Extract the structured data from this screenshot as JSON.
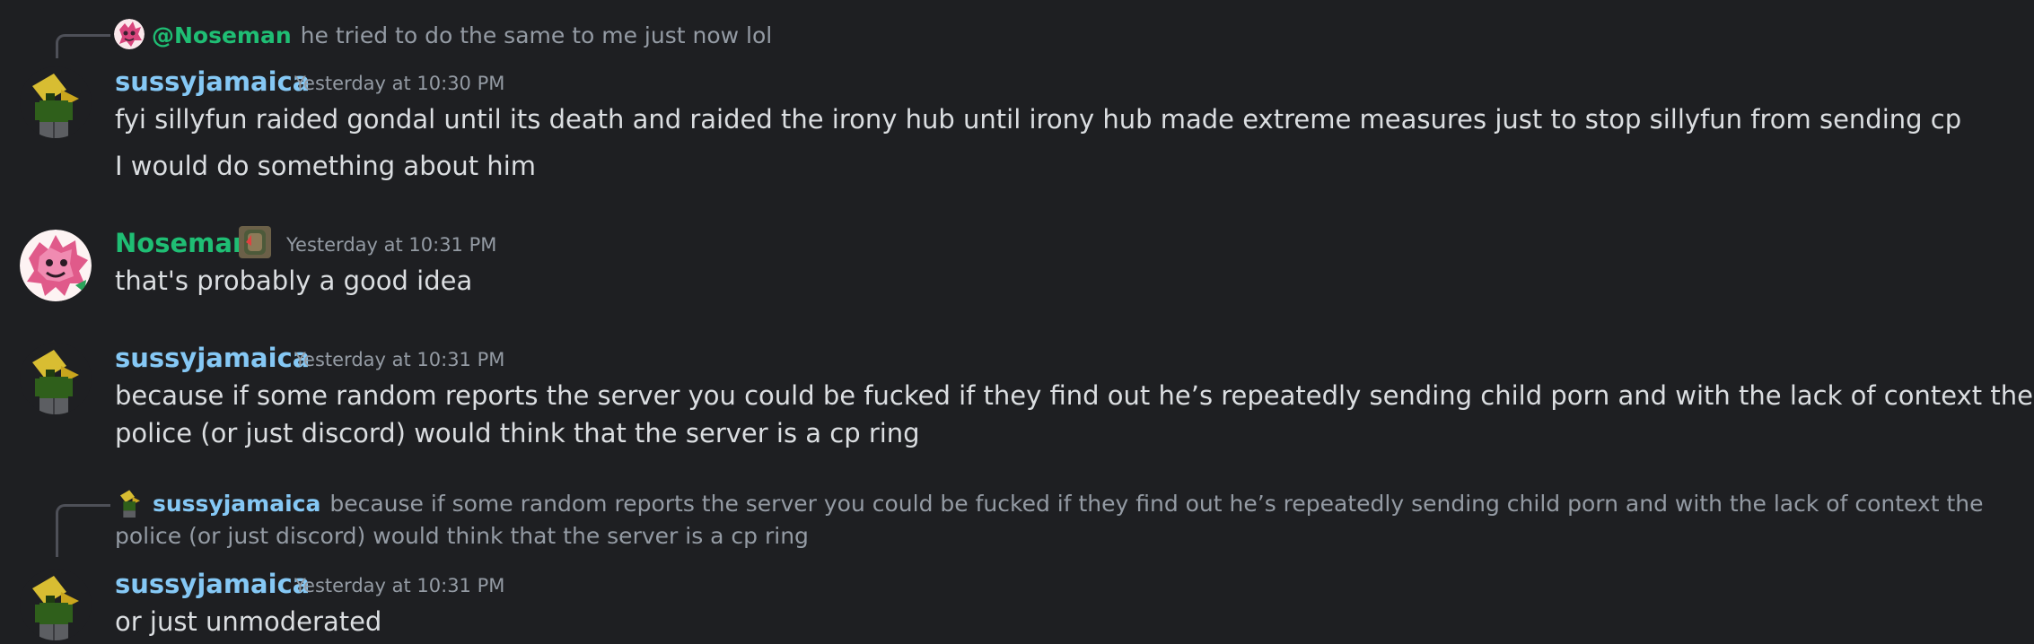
{
  "messages": [
    {
      "reply": {
        "author": "@Noseman",
        "text": "he tried to do the same to me just now lol"
      },
      "author": "sussyjamaica",
      "timestamp": "Yesterday at 10:30 PM",
      "lines": [
        "fyi sillyfun raided gondal until its death and raided the irony hub until irony hub made extreme measures just to stop sillyfun from sending cp",
        "I would do something about him"
      ]
    },
    {
      "author": "Noseman",
      "timestamp": "Yesterday at 10:31 PM",
      "lines": [
        "that's probably a good idea"
      ]
    },
    {
      "author": "sussyjamaica",
      "timestamp": "Yesterday at 10:31 PM",
      "lines": [
        "because if some random reports the server you could be fucked if they find out he’s repeatedly sending child porn and with the lack of context the police (or just discord) would think that the server is a cp ring"
      ]
    },
    {
      "reply": {
        "author": "sussyjamaica",
        "text": "because if some random reports the server you could be fucked if they find out he’s repeatedly sending child porn and with the lack of context the police (or just discord) would think that the server is a cp ring"
      },
      "author": "sussyjamaica",
      "timestamp": "Yesterday at 10:31 PM",
      "lines": [
        "or just unmoderated"
      ]
    }
  ],
  "colors": {
    "background": "#1e1f22",
    "author_blue": "#85c8f5",
    "author_green": "#1fbe74",
    "muted": "#949ba4",
    "text": "#dbdee1"
  }
}
